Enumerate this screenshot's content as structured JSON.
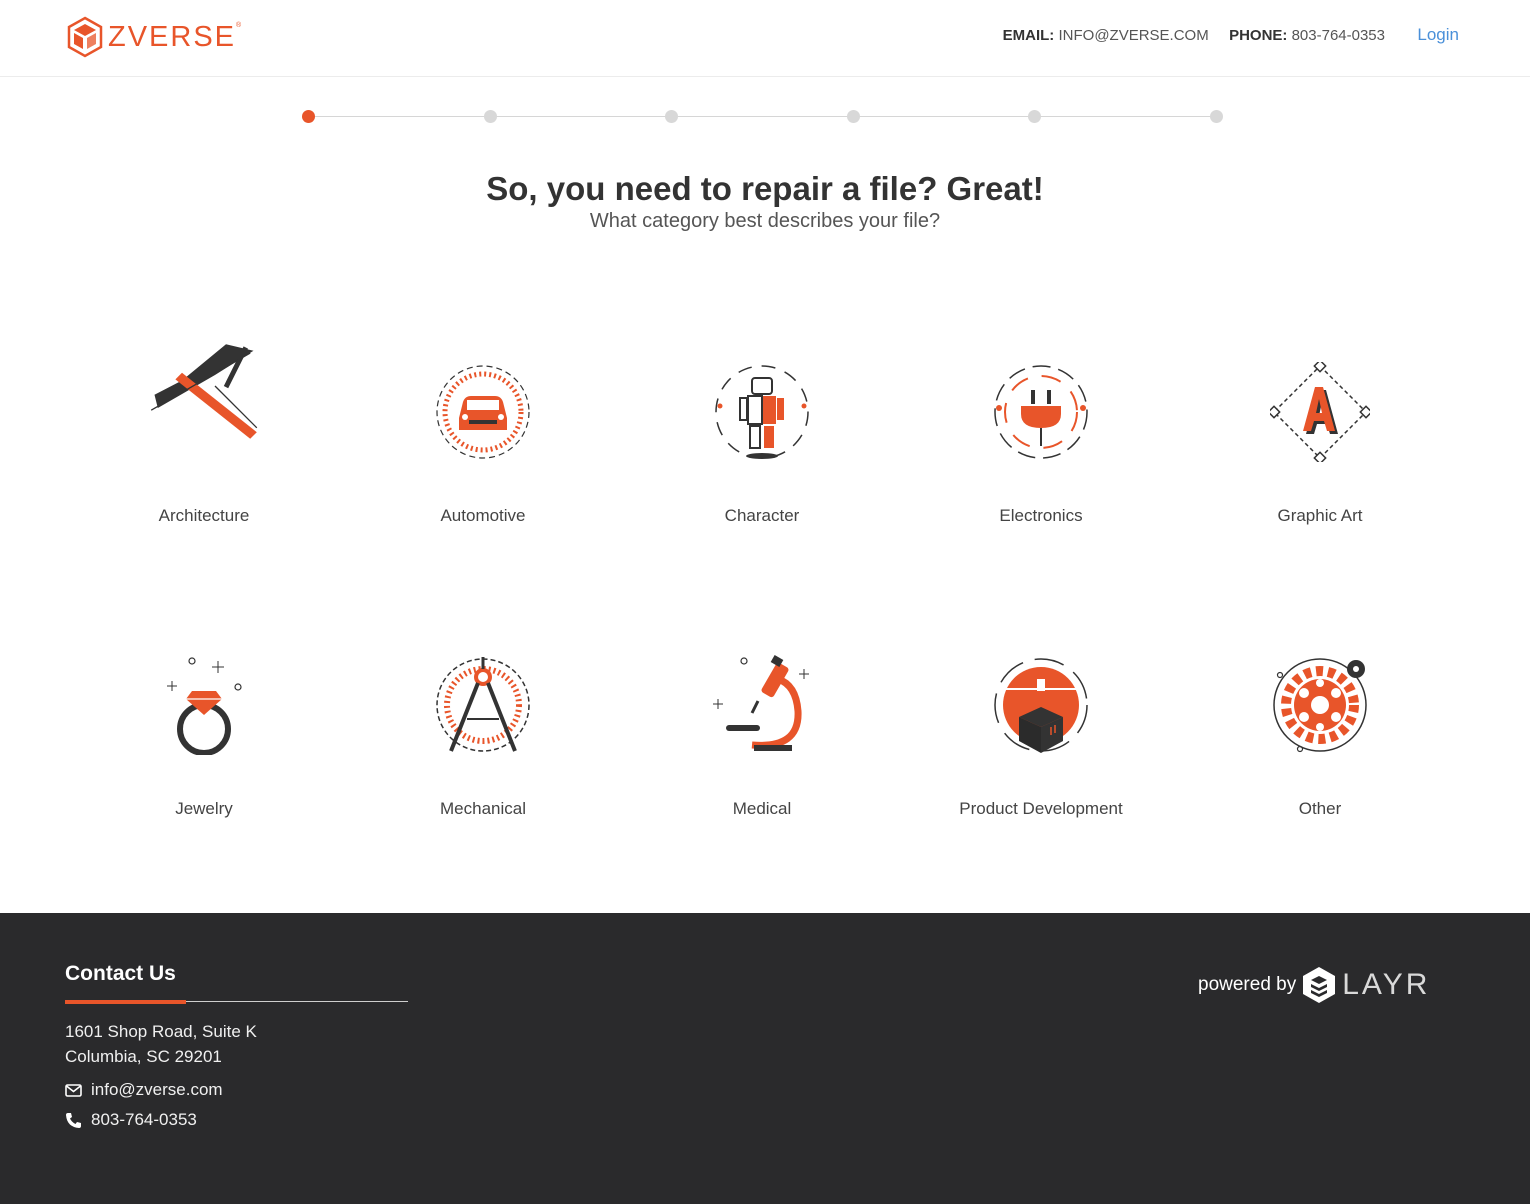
{
  "brand": {
    "name": "ZVERSE",
    "reg": "®",
    "accent": "#e8552a",
    "dark": "#333333"
  },
  "header": {
    "email_label": "EMAIL:",
    "email_value": "INFO@ZVERSE.COM",
    "phone_label": "PHONE:",
    "phone_value": "803-764-0353",
    "login_label": "Login"
  },
  "progress": {
    "total_steps": 6,
    "current_step": 1
  },
  "main": {
    "title": "So, you need to repair a file? Great!",
    "subtitle": "What category best describes your file?"
  },
  "categories": [
    {
      "label": "Architecture",
      "icon": "architecture-icon"
    },
    {
      "label": "Automotive",
      "icon": "car-icon"
    },
    {
      "label": "Character",
      "icon": "robot-icon"
    },
    {
      "label": "Electronics",
      "icon": "plug-icon"
    },
    {
      "label": "Graphic Art",
      "icon": "letter-a-icon"
    },
    {
      "label": "Jewelry",
      "icon": "ring-icon"
    },
    {
      "label": "Mechanical",
      "icon": "compass-icon"
    },
    {
      "label": "Medical",
      "icon": "microscope-icon"
    },
    {
      "label": "Product Development",
      "icon": "3d-printer-box-icon"
    },
    {
      "label": "Other",
      "icon": "gear-icon"
    }
  ],
  "footer": {
    "title": "Contact Us",
    "address_line1": "1601 Shop Road, Suite K",
    "address_line2": "Columbia, SC 29201",
    "email": "info@zverse.com",
    "phone": "803-764-0353",
    "powered_by": "powered by",
    "partner": "LAYR",
    "background": "#2a2a2c"
  }
}
